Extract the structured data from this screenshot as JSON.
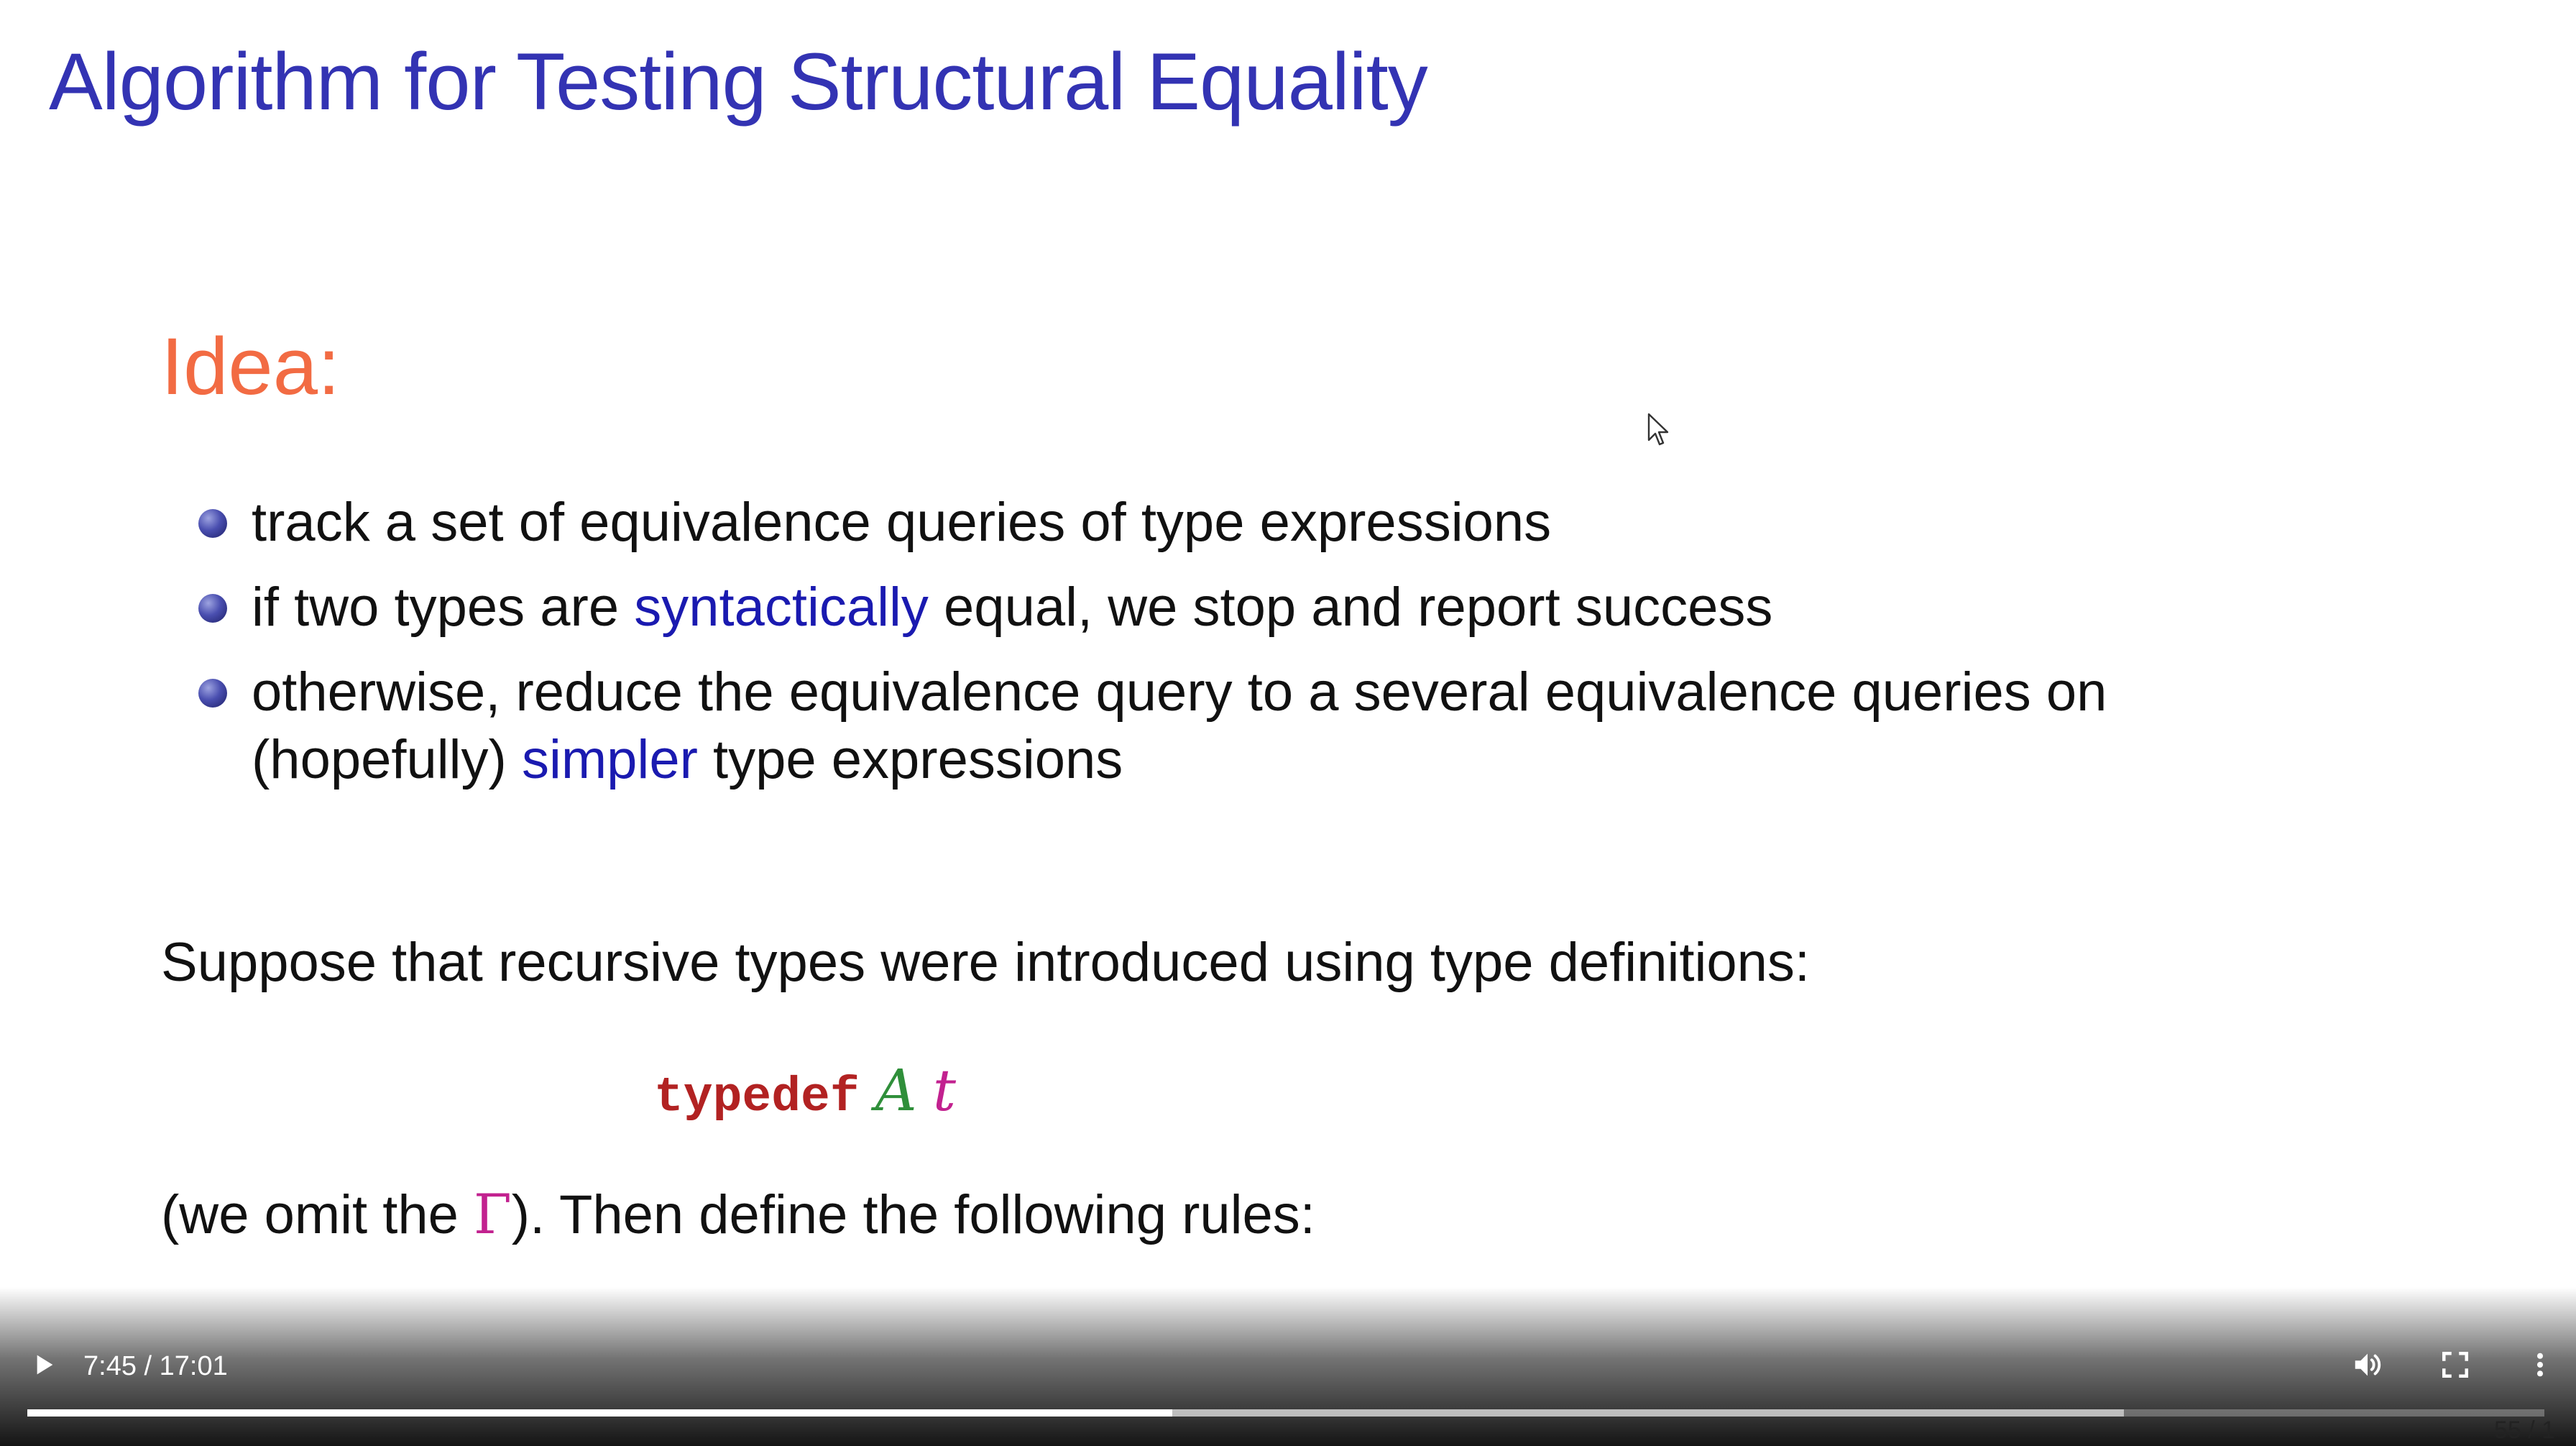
{
  "slide": {
    "title": "Algorithm for Testing Structural Equality",
    "idea_heading": "Idea:",
    "bullets": [
      {
        "parts": [
          "track a set of equivalence queries of type expressions"
        ]
      },
      {
        "parts": [
          "if two types are ",
          "syntactically",
          " equal, we stop and report success"
        ]
      },
      {
        "parts": [
          "otherwise, reduce the equivalence query to a several equivalence queries on (hopefully) ",
          "simpler",
          " type expressions"
        ]
      }
    ],
    "suppose_text": "Suppose that recursive types were introduced using type definitions:",
    "typedef": {
      "keyword": "typedef",
      "type_name": "A",
      "type_expr": "t"
    },
    "omit_text_before": "(we omit the ",
    "omit_symbol": "Γ",
    "omit_text_after": "). Then define the following rules:",
    "page_counter": "55 / 1"
  },
  "player": {
    "time": "7:45 / 17:01",
    "progress_played": 0.455,
    "progress_buffered": 0.833,
    "icons": {
      "play": "play-icon",
      "volume": "volume-icon",
      "fullscreen": "fullscreen-icon",
      "more": "more-vert-icon"
    }
  },
  "colors": {
    "title": "#3333b3",
    "idea": "#f26b43",
    "highlight": "#1a1ab0",
    "keyword": "#b22222",
    "type_name": "#2f8f3a",
    "type_expr": "#c2218f"
  }
}
